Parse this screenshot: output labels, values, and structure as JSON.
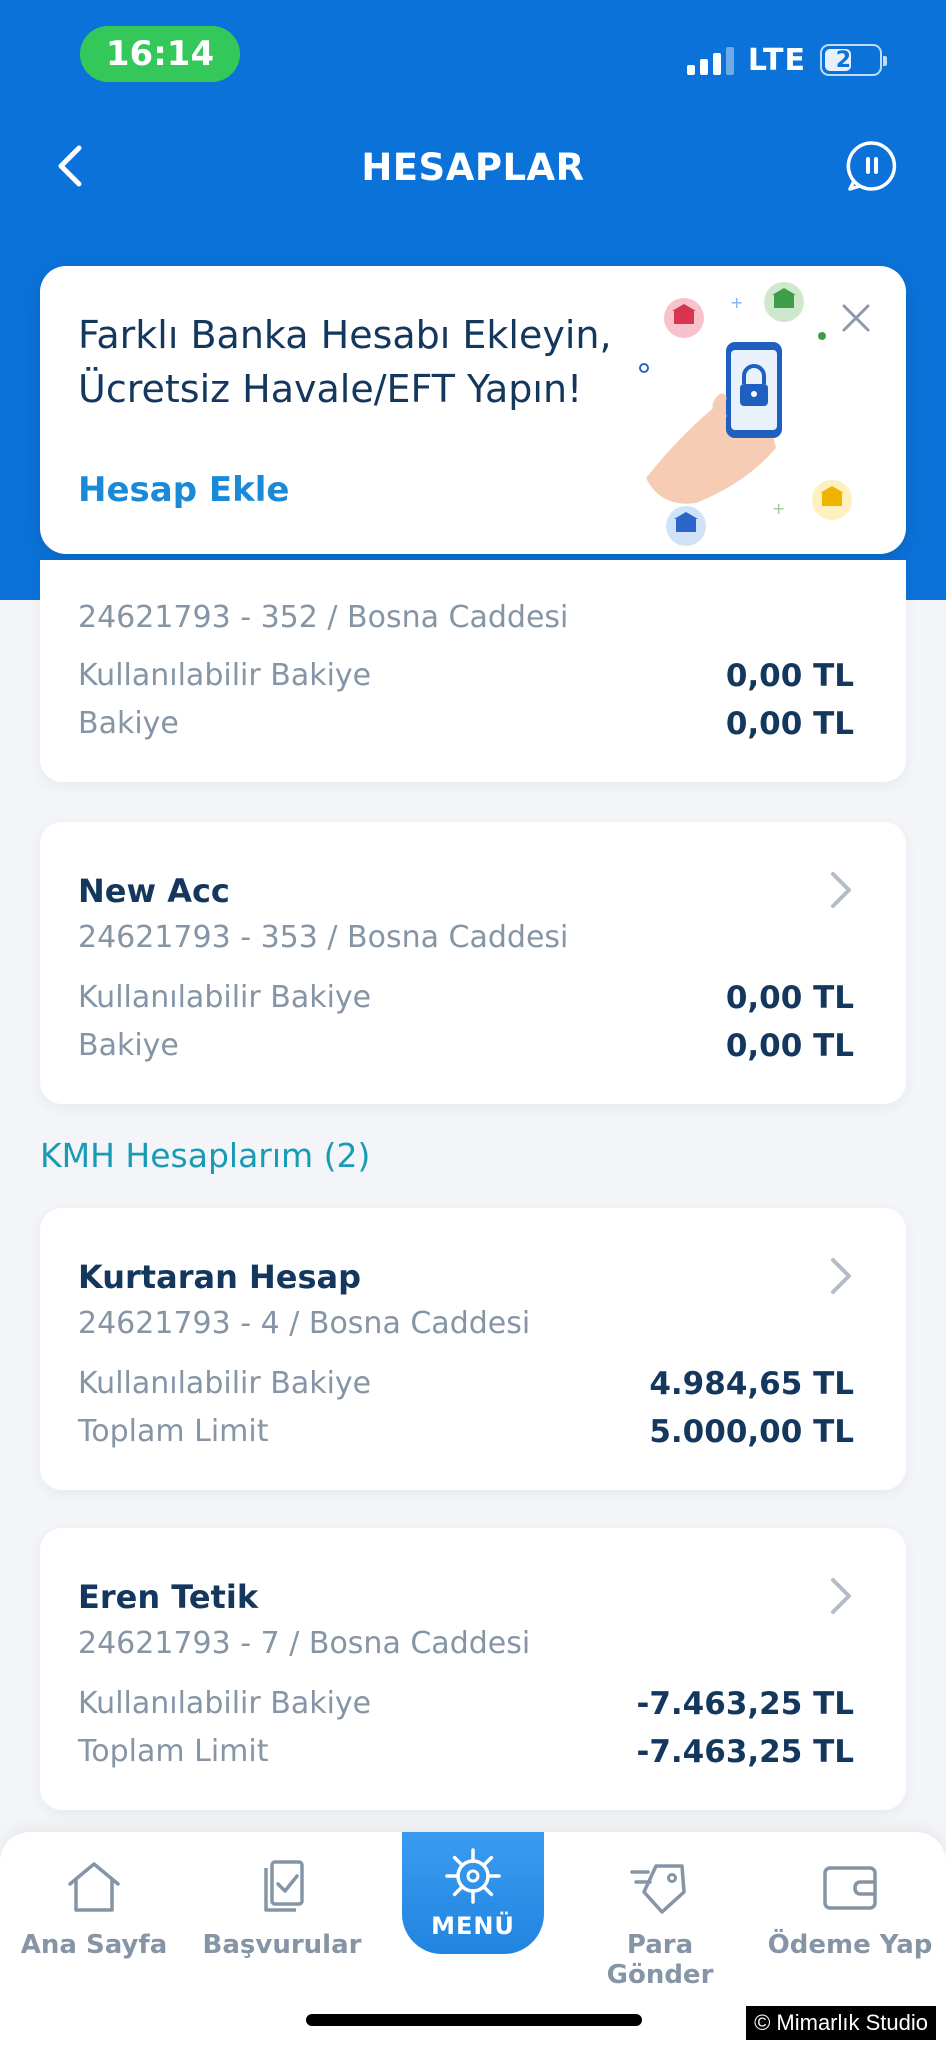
{
  "status_bar": {
    "time": "16:14",
    "network": "LTE",
    "battery": "21"
  },
  "header": {
    "title": "HESAPLAR"
  },
  "promo": {
    "title_line1": "Farklı Banka Hesabı Ekleyin,",
    "title_line2": "Ücretsiz Havale/EFT Yapın!",
    "link": "Hesap Ekle"
  },
  "accounts": [
    {
      "name": "",
      "number": "24621793 - 352 / Bosna Caddesi",
      "rows": [
        {
          "label": "Kullanılabilir Bakiye",
          "value": "0,00 TL"
        },
        {
          "label": "Bakiye",
          "value": "0,00 TL"
        }
      ]
    },
    {
      "name": "New Acc",
      "number": "24621793 - 353 / Bosna Caddesi",
      "rows": [
        {
          "label": "Kullanılabilir Bakiye",
          "value": "0,00 TL"
        },
        {
          "label": "Bakiye",
          "value": "0,00 TL"
        }
      ]
    }
  ],
  "kmh_section": {
    "title": "KMH Hesaplarım (2)"
  },
  "kmh_accounts": [
    {
      "name": "Kurtaran Hesap",
      "number": "24621793 - 4 / Bosna Caddesi",
      "rows": [
        {
          "label": "Kullanılabilir Bakiye",
          "value": "4.984,65 TL"
        },
        {
          "label": "Toplam Limit",
          "value": "5.000,00 TL"
        }
      ]
    },
    {
      "name": "Eren Tetik",
      "number": "24621793 - 7 / Bosna Caddesi",
      "rows": [
        {
          "label": "Kullanılabilir Bakiye",
          "value": "-7.463,25 TL"
        },
        {
          "label": "Toplam Limit",
          "value": "-7.463,25 TL"
        }
      ]
    }
  ],
  "bottom_nav": {
    "home": "Ana Sayfa",
    "applications": "Başvurular",
    "menu": "MENÜ",
    "send_money": "Para Gönder",
    "pay": "Ödeme Yap"
  },
  "watermark": "© Mimarlık Studio",
  "colors": {
    "primary_blue": "#0b72d9",
    "text_dark": "#14375e",
    "text_muted": "#8595a6",
    "section_teal": "#1a9bb5",
    "link_blue": "#1a8ad8",
    "status_green": "#34c759"
  }
}
